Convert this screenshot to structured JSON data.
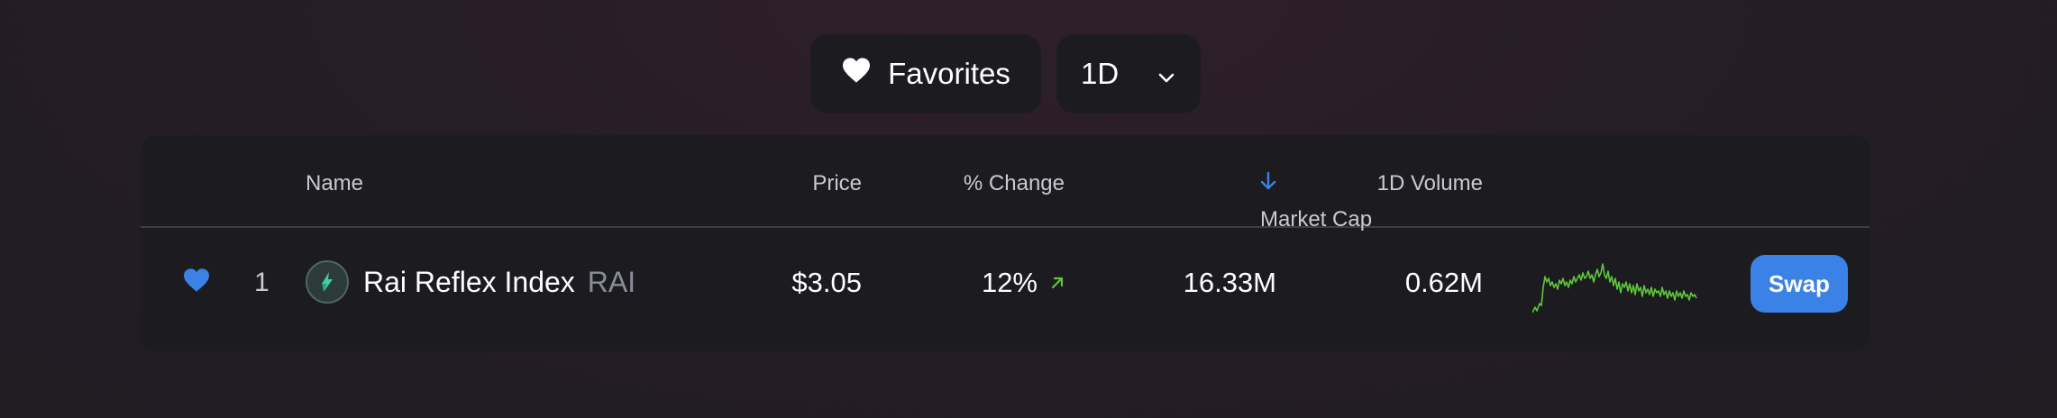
{
  "controls": {
    "favorites_label": "Favorites",
    "time_period": "1D"
  },
  "table": {
    "headers": {
      "name": "Name",
      "price": "Price",
      "change": "% Change",
      "market_cap": "Market Cap",
      "volume": "1D Volume"
    },
    "sorted_by": "market_cap",
    "sort_direction": "descending",
    "rows": [
      {
        "favorited": true,
        "rank": "1",
        "name": "Rai Reflex Index",
        "symbol": "RAI",
        "price": "$3.05",
        "change": "12%",
        "change_direction": "up",
        "market_cap": "16.33M",
        "volume": "0.62M",
        "swap_label": "Swap"
      }
    ]
  },
  "colors": {
    "accent": "#3b82e6",
    "positive": "#5ec73a",
    "sort_header": "#3b82e6"
  }
}
